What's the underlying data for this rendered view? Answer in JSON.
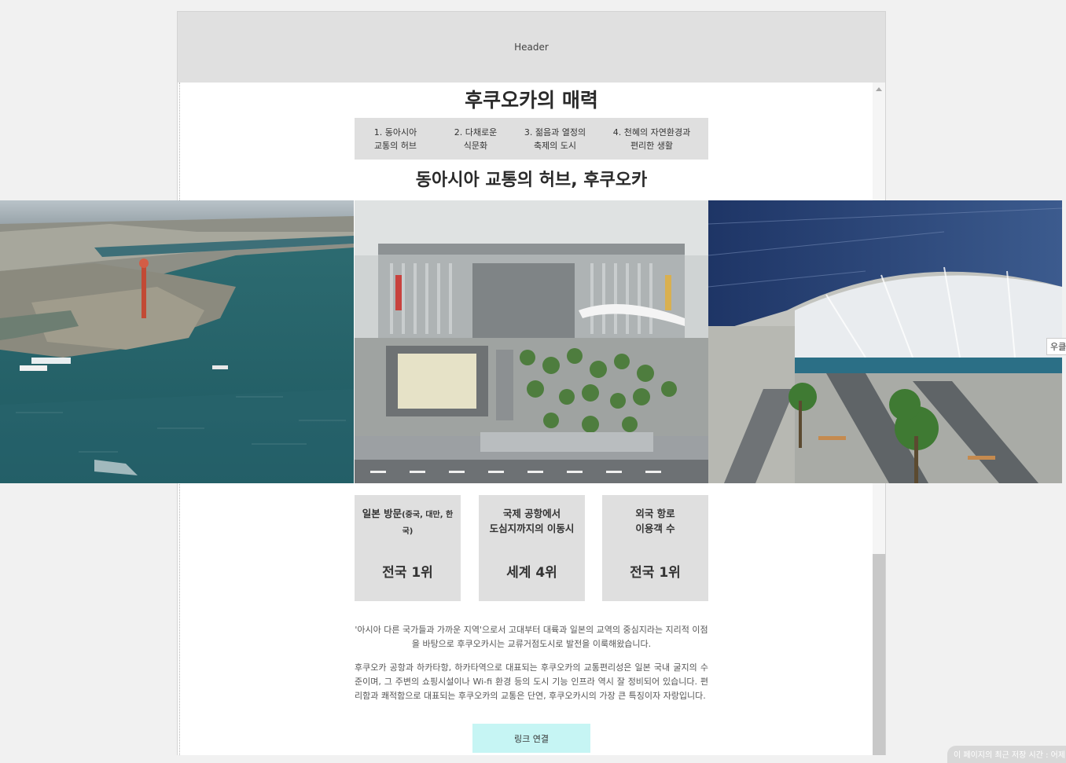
{
  "header": {
    "label": "Header"
  },
  "page": {
    "title": "후쿠오카의 매력",
    "subtitle": "동아시아 교통의 허브, 후쿠오카"
  },
  "tabs": [
    {
      "line1": "1. 동아시아",
      "line2": "교통의 허브"
    },
    {
      "line1": "2. 다채로운",
      "line2": "식문화"
    },
    {
      "line1": "3. 젊음과 열정의",
      "line2": "축제의 도시"
    },
    {
      "line1": "4. 천혜의 자연환경과",
      "line2": "편리한 생활"
    }
  ],
  "side_tab": {
    "label": "우클"
  },
  "stats": [
    {
      "label_main": "일본 방문",
      "label_small": "(중국, 대만, 한국)",
      "value": "전국 1위"
    },
    {
      "label_line1": "국제 공항에서",
      "label_line2": "도심지까지의 이동시",
      "value": "세계 4위"
    },
    {
      "label_line1": "외국 항로",
      "label_line2": "이용객 수",
      "value": "전국 1위"
    }
  ],
  "paragraphs": [
    "'아시아 다른 국가들과 가까운 지역'으로서 고대부터 대륙과 일본의 교역의 중심지라는 지리적 이점을 바탕으로 후쿠오카시는 교류거점도시로 발전을 이룩해왔습니다.",
    "후쿠오카 공항과 하카타항, 하카타역으로 대표되는 후쿠오카의 교통편리성은 일본 국내 굴지의 수준이며, 그 주변의 쇼핑시설이나 Wi-fi 환경 등의 도시 기능 인프라 역시 잘 정비되어 있습니다. 편리함과 쾌적함으로 대표되는 후쿠오카의 교통은 단연, 후쿠오카시의 가장 큰 특징이자 자랑입니다."
  ],
  "link_button": {
    "label": "링크 연결"
  },
  "notice": {
    "text": "이 페이지의 최근 저장 시간 : 어제"
  },
  "colors": {
    "header_bg": "#e0e0e0",
    "tab_bg": "#dfdfdf",
    "stat_bg": "#dfdfdf",
    "link_button_bg": "#c6f5f4",
    "page_bg": "#f1f1f1"
  }
}
